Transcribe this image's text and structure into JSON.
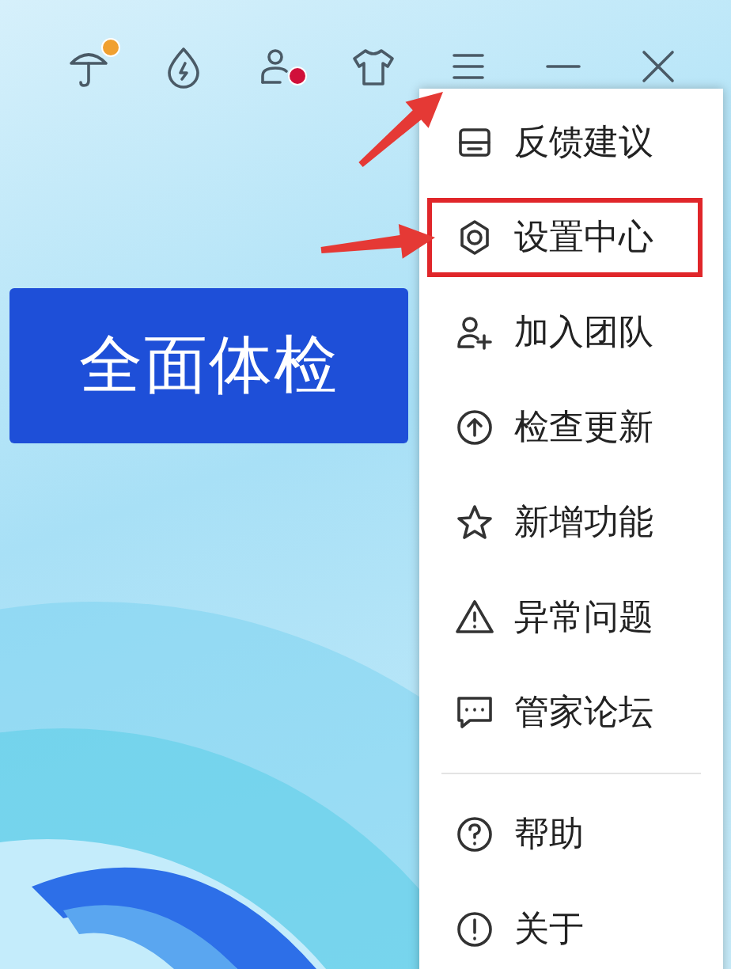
{
  "toolbar": [
    {
      "kind": "umbrella",
      "color": "#f0a030"
    },
    {
      "kind": "drop"
    },
    {
      "kind": "person",
      "color": "#d0103a"
    },
    {
      "kind": "shirt"
    },
    {
      "kind": "menu",
      "pointed": true
    },
    {
      "kind": "minimize"
    },
    {
      "kind": "close"
    }
  ],
  "main_button": {
    "label": "全面体检"
  },
  "menu": {
    "groups": [
      [
        {
          "kind": "feedback",
          "label": "反馈建议",
          "highlighted": false,
          "pointed": false
        },
        {
          "kind": "settings",
          "label": "设置中心",
          "highlighted": true,
          "pointed": true
        },
        {
          "kind": "team",
          "label": "加入团队",
          "highlighted": false,
          "pointed": false
        },
        {
          "kind": "update",
          "label": "检查更新",
          "highlighted": false,
          "pointed": false
        },
        {
          "kind": "star",
          "label": "新增功能",
          "highlighted": false,
          "pointed": false
        },
        {
          "kind": "warning",
          "label": "异常问题",
          "highlighted": false,
          "pointed": false
        },
        {
          "kind": "forum",
          "label": "管家论坛",
          "highlighted": false,
          "pointed": false
        }
      ],
      [
        {
          "kind": "help",
          "label": "帮助",
          "highlighted": false,
          "pointed": false
        },
        {
          "kind": "about",
          "label": "关于",
          "highlighted": false,
          "pointed": false
        }
      ]
    ]
  }
}
